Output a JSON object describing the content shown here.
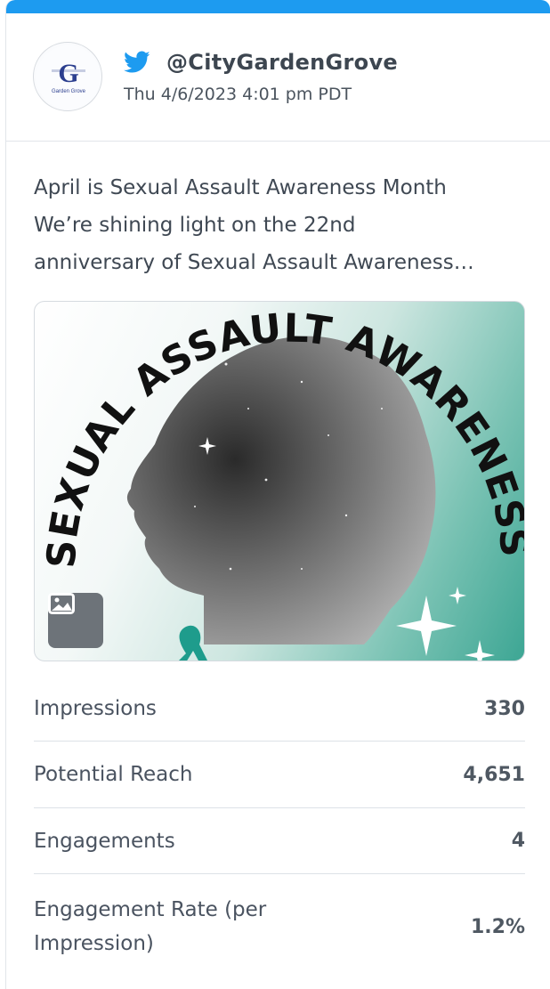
{
  "colors": {
    "accent_bar": "#1d9bf0",
    "twitter_blue": "#1d9bf0",
    "text_primary": "#3d4650"
  },
  "post": {
    "platform_icon": "twitter-bird-icon",
    "handle": "@CityGardenGrove",
    "timestamp": "Thu 4/6/2023 4:01 pm PDT",
    "avatar_logo_letter": "G",
    "avatar_logo_text": "Garden Grove",
    "text_lines": [
      "April is Sexual Assault Awareness Month",
      "We’re shining light on the 22nd",
      "anniversary of Sexual Assault Awareness…"
    ],
    "media": {
      "arc_text": "SEXUAL ASSAULT AWARENESS MONTH",
      "badge_icon": "image-icon"
    }
  },
  "stats": [
    {
      "label": "Impressions",
      "value": "330"
    },
    {
      "label": "Potential Reach",
      "value": "4,651"
    },
    {
      "label": "Engagements",
      "value": "4"
    },
    {
      "label": "Engagement Rate (per Impression)",
      "value": "1.2%"
    }
  ]
}
